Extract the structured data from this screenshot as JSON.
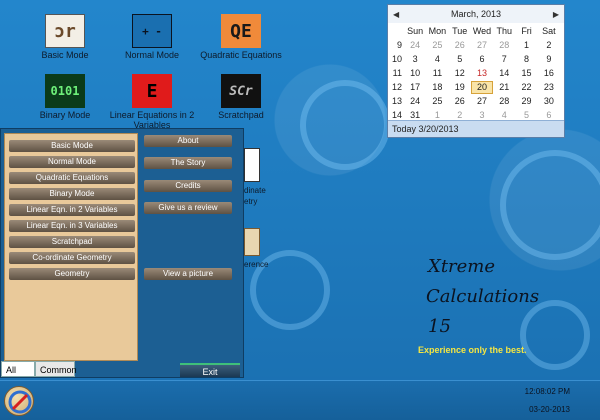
{
  "desktop": {
    "icons": [
      {
        "label": "Basic Mode",
        "glyph": "ɔr"
      },
      {
        "label": "Normal Mode",
        "glyph": "+ -"
      },
      {
        "label": "Quadratic Equations",
        "glyph": "QE"
      },
      {
        "label": "Binary Mode",
        "glyph": "0101"
      },
      {
        "label": "Linear Equations in 2 Variables",
        "glyph": "E"
      },
      {
        "label": "Scratchpad",
        "glyph": "SCr"
      }
    ],
    "partial_labels": [
      "dinate",
      "etry",
      "erence"
    ]
  },
  "calendar": {
    "title": "March, 2013",
    "weekdays": [
      "Sun",
      "Mon",
      "Tue",
      "Wed",
      "Thu",
      "Fri",
      "Sat"
    ],
    "weeks": [
      {
        "wk": "9",
        "days": [
          "24",
          "25",
          "26",
          "27",
          "28",
          "1",
          "2"
        ]
      },
      {
        "wk": "10",
        "days": [
          "3",
          "4",
          "5",
          "6",
          "7",
          "8",
          "9"
        ]
      },
      {
        "wk": "11",
        "days": [
          "10",
          "11",
          "12",
          "13",
          "14",
          "15",
          "16"
        ]
      },
      {
        "wk": "12",
        "days": [
          "17",
          "18",
          "19",
          "20",
          "21",
          "22",
          "23"
        ]
      },
      {
        "wk": "13",
        "days": [
          "24",
          "25",
          "26",
          "27",
          "28",
          "29",
          "30"
        ]
      },
      {
        "wk": "14",
        "days": [
          "31",
          "1",
          "2",
          "3",
          "4",
          "5",
          "6"
        ]
      }
    ],
    "today_label": "Today 3/20/2013"
  },
  "menu": {
    "left_items": [
      "Basic Mode",
      "Normal Mode",
      "Quadratic Equations",
      "Binary Mode",
      "Linear Eqn. in 2 Variables",
      "Linear Eqn. in 3 Variables",
      "Scratchpad",
      "Co-ordinate Geometry",
      "Geometry"
    ],
    "right_items": [
      "About",
      "The Story",
      "Credits",
      "Give us a review"
    ],
    "picture_button": "View a picture",
    "exit_button": "Exit",
    "tabs": {
      "all": "All",
      "common": "Common"
    }
  },
  "brand": {
    "line1": "Xtreme",
    "line2": "Calculations",
    "line3": "15",
    "tagline": "Experience only the best."
  },
  "taskbar": {
    "time": "12:08:02 PM",
    "date": "03-20-2013"
  },
  "colors": {
    "desktop": "#1f7fc4",
    "menu_bg": "#1c5f93",
    "menu_left_bg": "#e9c99a",
    "tagline": "#f5e642"
  }
}
